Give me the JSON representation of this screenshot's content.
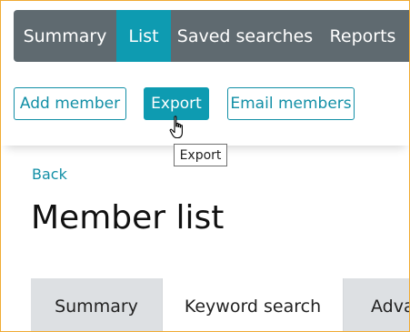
{
  "topnav": {
    "tabs": [
      {
        "label": "Summary",
        "active": false
      },
      {
        "label": "List",
        "active": true
      },
      {
        "label": "Saved searches",
        "active": false
      },
      {
        "label": "Reports",
        "active": false
      }
    ]
  },
  "toolbar": {
    "add_member_label": "Add member",
    "export_label": "Export",
    "email_members_label": "Email members"
  },
  "tooltip": {
    "text": "Export"
  },
  "page": {
    "back_label": "Back",
    "title": "Member list"
  },
  "search_tabs": [
    {
      "label": "Summary",
      "active": false
    },
    {
      "label": "Keyword search",
      "active": true
    },
    {
      "label": "Adva",
      "active": false
    }
  ],
  "colors": {
    "nav_bg": "#5f6a70",
    "accent": "#0e9bb1",
    "link": "#128fa6",
    "frame_border": "#f0ab34"
  },
  "icons": {
    "cursor": "hand-pointer-icon"
  }
}
